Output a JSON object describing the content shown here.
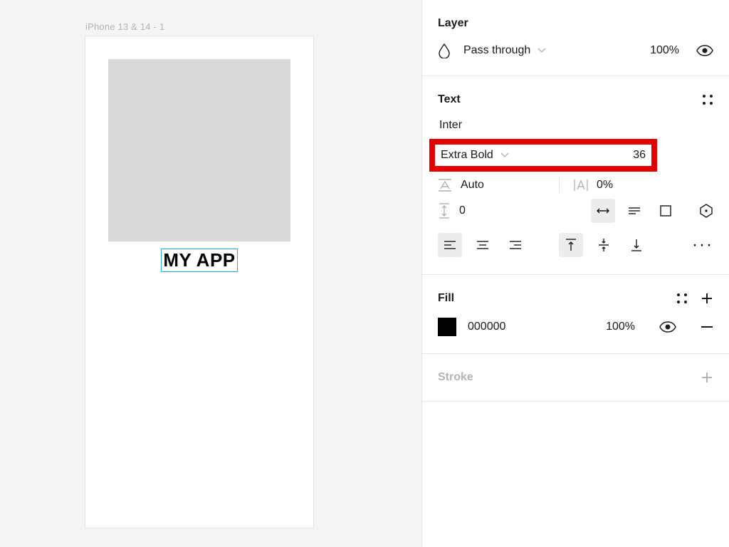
{
  "canvas": {
    "frame_label": "iPhone 13 & 14 - 1",
    "text_element": "MY APP"
  },
  "panel": {
    "layer": {
      "title": "Layer",
      "blend_mode": "Pass through",
      "opacity": "100%"
    },
    "text": {
      "title": "Text",
      "font_family": "Inter",
      "font_weight": "Extra Bold",
      "font_size": "36",
      "line_height": "Auto",
      "letter_spacing": "0%",
      "paragraph_spacing": "0"
    },
    "fill": {
      "title": "Fill",
      "hex": "000000",
      "opacity": "100%"
    },
    "stroke": {
      "title": "Stroke"
    }
  }
}
